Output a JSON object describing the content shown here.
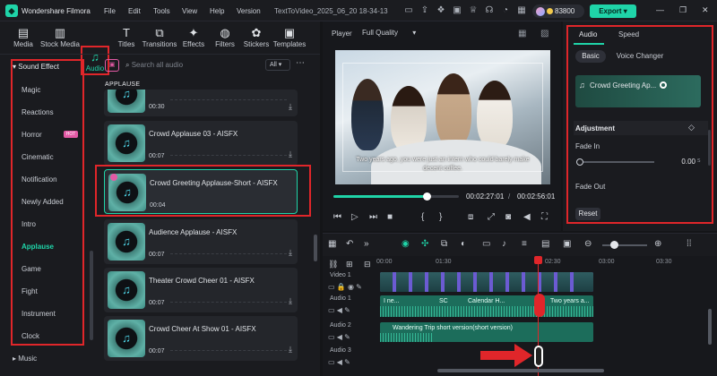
{
  "app": {
    "name": "Wondershare Filmora",
    "project_title": "TextToVideo_2025_06_20 18-34-13",
    "credits": "83800",
    "export_label": "Export"
  },
  "menu": [
    "File",
    "Edit",
    "Tools",
    "View",
    "Help",
    "Version"
  ],
  "tabs": [
    {
      "label": "Media",
      "icon": "media-icon"
    },
    {
      "label": "Stock Media",
      "icon": "stock-media-icon"
    },
    {
      "label": "Audio",
      "icon": "music-note-icon"
    },
    {
      "label": "Titles",
      "icon": "titles-icon"
    },
    {
      "label": "Transitions",
      "icon": "transitions-icon"
    },
    {
      "label": "Effects",
      "icon": "effects-icon"
    },
    {
      "label": "Filters",
      "icon": "filters-icon"
    },
    {
      "label": "Stickers",
      "icon": "stickers-icon"
    },
    {
      "label": "Templates",
      "icon": "templates-icon"
    }
  ],
  "sidebar": {
    "header": "Sound Effect",
    "items": [
      "Magic",
      "Reactions",
      "Horror",
      "Cinematic",
      "Notification",
      "Newly Added",
      "Intro",
      "Applause",
      "Game",
      "Fight",
      "Instrument",
      "Clock"
    ],
    "hot_badge": "HOT",
    "footer": "Music"
  },
  "audio_list": {
    "search_placeholder": "Search all audio",
    "filter": "All",
    "category": "APPLAUSE",
    "items": [
      {
        "title": "",
        "duration": "00:30"
      },
      {
        "title": "Crowd Applause 03 - AISFX",
        "duration": "00:07"
      },
      {
        "title": "Crowd Greeting Applause-Short - AISFX",
        "duration": "00:04"
      },
      {
        "title": "Audience Applause - AISFX",
        "duration": "00:07"
      },
      {
        "title": "Theater Crowd Cheer 01 - AISFX",
        "duration": "00:07"
      },
      {
        "title": "Crowd Cheer At Show 01 - AISFX",
        "duration": "00:07"
      }
    ]
  },
  "player": {
    "label": "Player",
    "quality": "Full Quality",
    "caption": "Two years ago, you were just an intern who could barely make decent coffee.",
    "current_time": "00:02:27:01",
    "total_time": "00:02:56:01",
    "progress": 0.74
  },
  "properties": {
    "tabs": [
      "Audio",
      "Speed"
    ],
    "subtabs": [
      "Basic",
      "Voice Changer"
    ],
    "clip_name": "Crowd Greeting Ap...",
    "adjustment_label": "Adjustment",
    "fade_in_label": "Fade In",
    "fade_in_value": "0.00",
    "fade_unit": "s",
    "fade_out_label": "Fade Out",
    "reset_label": "Reset"
  },
  "timeline": {
    "ruler": [
      "00:00",
      "01:30",
      "02:30",
      "03:00",
      "03:30"
    ],
    "tracks": [
      "Video 1",
      "Audio 1",
      "Audio 2",
      "Audio 3"
    ],
    "audio1_labels": [
      "I ne...",
      "SC",
      "Calendar H...",
      "Two years a..."
    ],
    "audio2_label": "Wandering Trip short version(short version)"
  },
  "colors": {
    "accent": "#1fd4a8",
    "highlight": "#e0262a",
    "bg": "#141518"
  }
}
